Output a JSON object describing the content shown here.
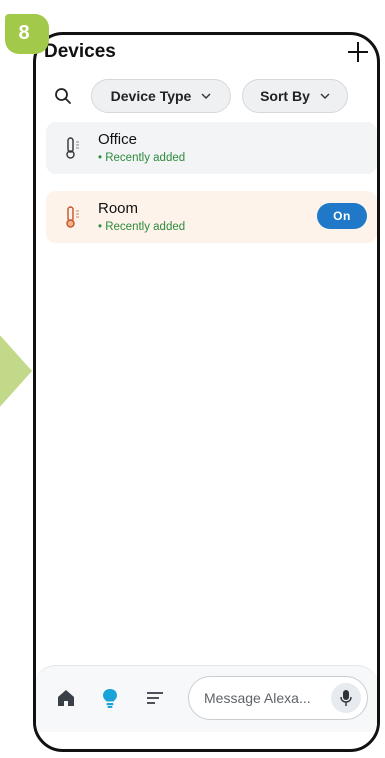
{
  "step": {
    "number": "8"
  },
  "header": {
    "title": "Devices",
    "add_icon": "plus-icon"
  },
  "filters": {
    "search_icon": "search-icon",
    "device_type_label": "Device Type",
    "sort_by_label": "Sort By",
    "chevron": "⌄"
  },
  "devices": [
    {
      "name": "Office",
      "status": "• Recently added",
      "icon": "thermometer-icon",
      "state": ""
    },
    {
      "name": "Room",
      "status": "• Recently added",
      "icon": "thermometer-icon",
      "state": "On"
    }
  ],
  "bottom_nav": {
    "items": [
      "home-icon",
      "devices-icon",
      "more-icon"
    ],
    "message_placeholder": "Message Alexa...",
    "mic_icon": "microphone-icon"
  },
  "colors": {
    "badge": "#a3c94a",
    "accent_on": "#1f78c8",
    "status_green": "#2e8b3d",
    "active_icon": "#1aa3d8",
    "room_card": "#fdf3ea",
    "office_card": "#f2f4f6"
  }
}
